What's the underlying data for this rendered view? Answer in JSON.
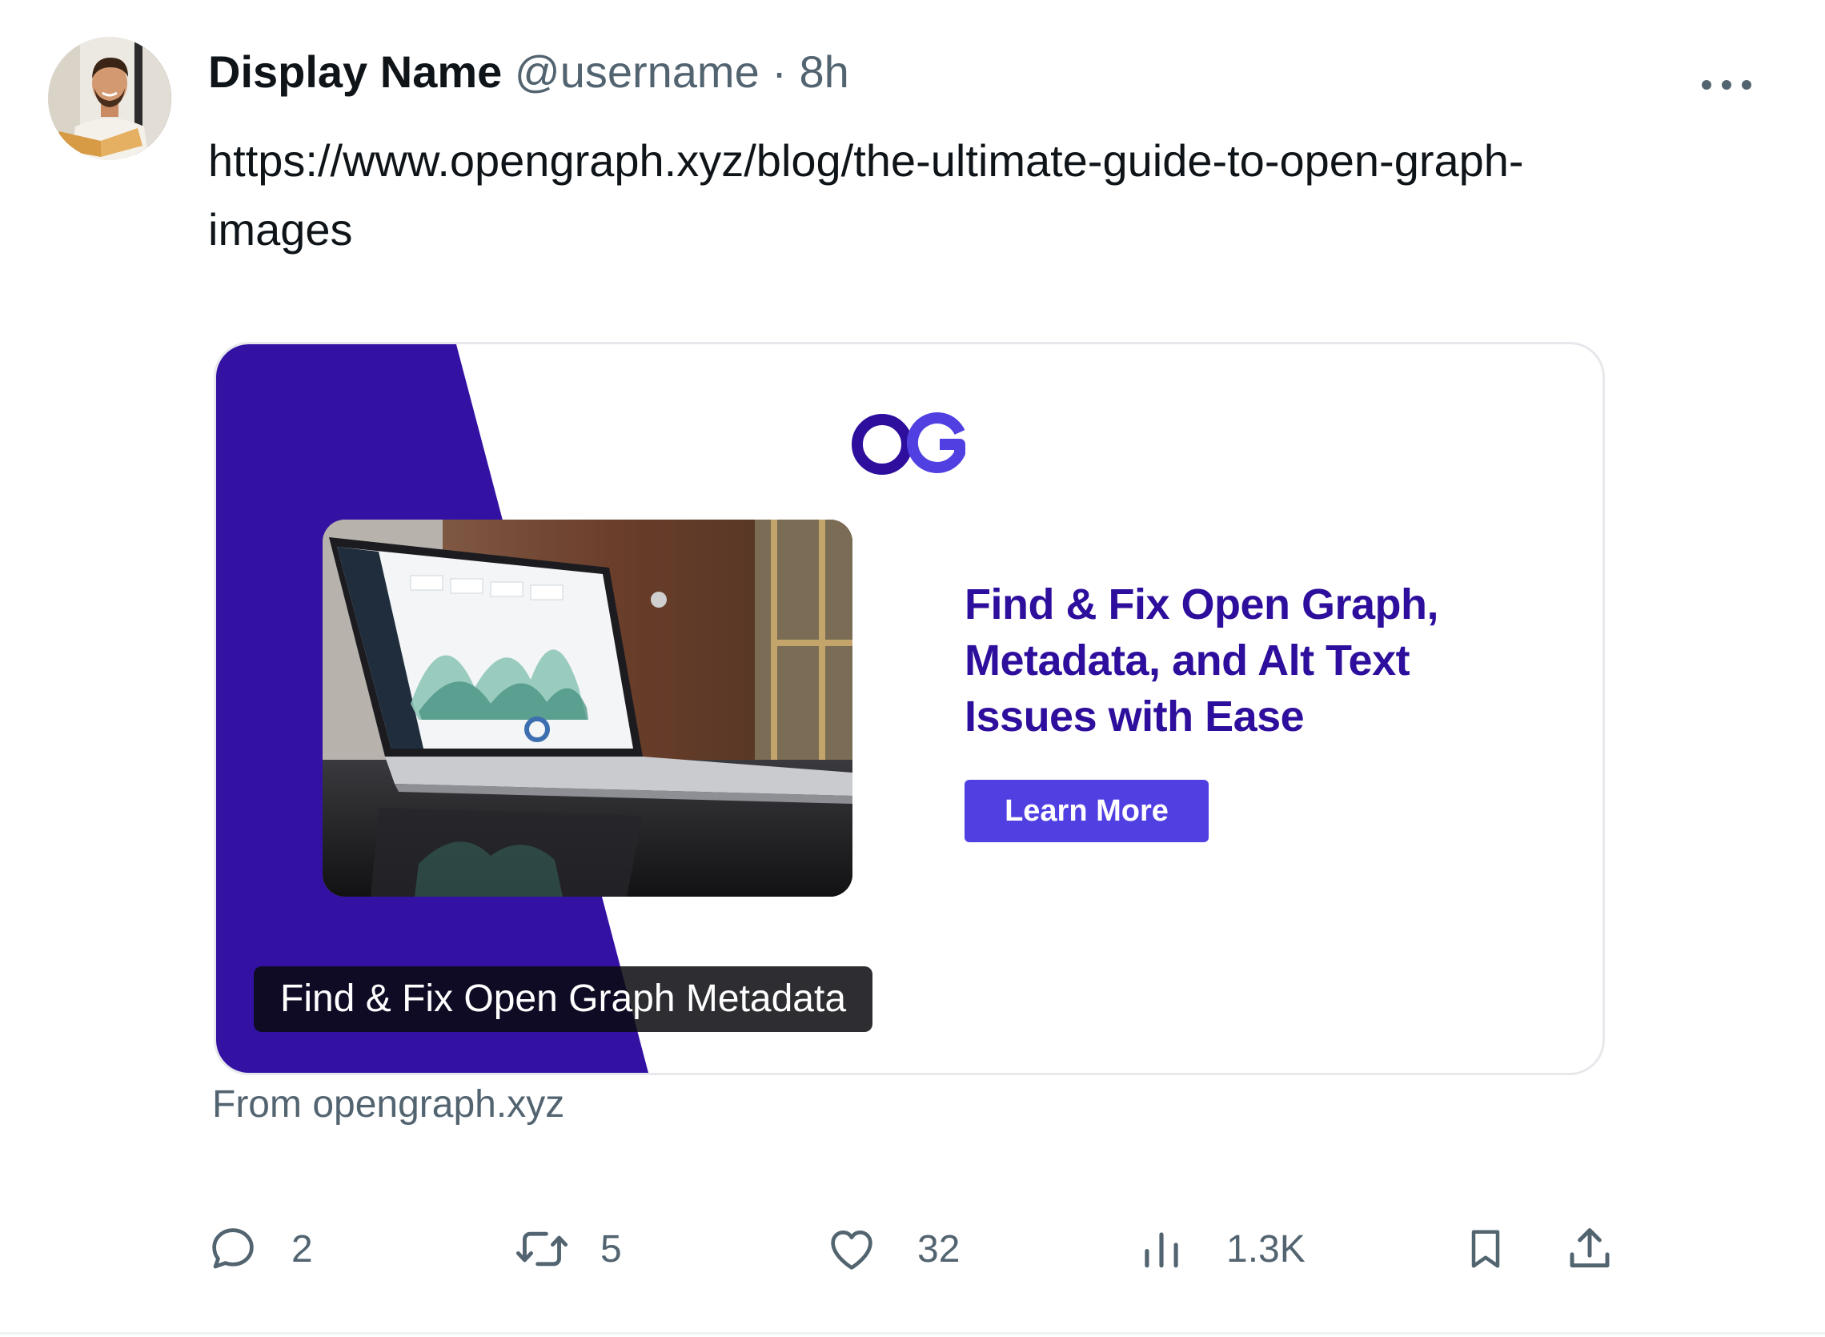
{
  "post": {
    "display_name": "Display Name",
    "handle": "@username",
    "separator": "·",
    "time": "8h",
    "text": "https://www.opengraph.xyz/blog/the-ultimate-guide-to-open-graph-images",
    "more_icon": "more-horizontal-icon"
  },
  "card": {
    "logo_text": "OG",
    "headline": "Find & Fix Open Graph, Metadata, and Alt Text Issues with Ease",
    "cta_label": "Learn More",
    "alt_text": "Find & Fix Open Graph Metadata",
    "source": "From opengraph.xyz",
    "colors": {
      "brand_purple": "#2e0e9c",
      "brand_button": "#5040e2",
      "panel": "#3312a3"
    }
  },
  "actions": {
    "reply_count": "2",
    "repost_count": "5",
    "like_count": "32",
    "views_count": "1.3K",
    "icons": [
      "reply-icon",
      "repost-icon",
      "like-icon",
      "views-icon",
      "bookmark-icon",
      "share-icon"
    ]
  }
}
